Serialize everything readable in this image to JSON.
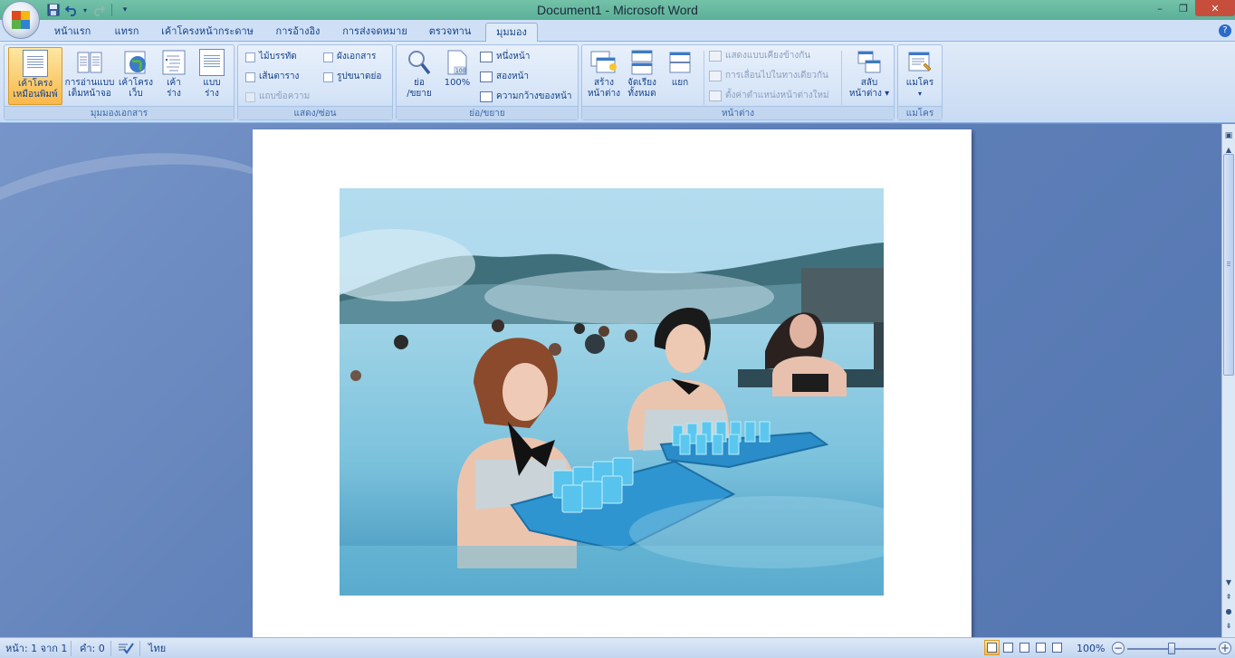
{
  "window": {
    "title": "Document1 - Microsoft Word",
    "close_label": "✕",
    "minimize_label": "–",
    "restore_label": "❐"
  },
  "tabs": [
    {
      "label": "หน้าแรก",
      "active": false
    },
    {
      "label": "แทรก",
      "active": false
    },
    {
      "label": "เค้าโครงหน้ากระดาษ",
      "active": false
    },
    {
      "label": "การอ้างอิง",
      "active": false
    },
    {
      "label": "การส่งจดหมาย",
      "active": false
    },
    {
      "label": "ตรวจทาน",
      "active": false
    },
    {
      "label": "มุมมอง",
      "active": true
    }
  ],
  "ribbon": {
    "document_views": {
      "label": "มุมมองเอกสาร",
      "print_layout": {
        "line1": "เค้าโครง",
        "line2": "เหมือนพิมพ์"
      },
      "full_screen": {
        "line1": "การอ่านแบบ",
        "line2": "เต็มหน้าจอ"
      },
      "web_layout": {
        "line1": "เค้าโครง",
        "line2": "เว็บ"
      },
      "outline": {
        "line1": "เค้า",
        "line2": "ร่าง"
      },
      "draft": {
        "line1": "แบบ",
        "line2": "ร่าง"
      }
    },
    "show_hide": {
      "label": "แสดง/ซ่อน",
      "ruler": "ไม้บรรทัด",
      "gridlines": "เส้นตาราง",
      "message_bar": "แถบข้อความ",
      "document_map": "ผังเอกสาร",
      "thumbnails": "รูปขนาดย่อ"
    },
    "zoom": {
      "label": "ย่อ/ขยาย",
      "zoom_btn": {
        "line1": "ย่อ",
        "line2": "/ขยาย"
      },
      "hundred": "100%",
      "one_page": "หนึ่งหน้า",
      "two_pages": "สองหน้า",
      "page_width": "ความกว้างของหน้า"
    },
    "window": {
      "label": "หน้าต่าง",
      "new_window": {
        "line1": "สร้าง",
        "line2": "หน้าต่าง"
      },
      "arrange_all": {
        "line1": "จัดเรียง",
        "line2": "ทั้งหมด"
      },
      "split": "แยก",
      "side_by_side": "แสดงแบบเคียงข้างกัน",
      "sync_scroll": "การเลื่อนไปในทางเดียวกัน",
      "reset_position": "ตั้งค่าตำแหน่งหน้าต่างใหม่",
      "switch_windows": {
        "line1": "สลับ",
        "line2": "หน้าต่าง ▾"
      }
    },
    "macros": {
      "label": "แมโคร",
      "macros_btn": {
        "line1": "แมโคร",
        "line2": "▾"
      }
    }
  },
  "status": {
    "page": "หน้า: 1 จาก 1",
    "words": "คำ: 0",
    "language": "ไทย",
    "zoom_level": "100%",
    "zoom_minus": "−",
    "zoom_plus": "+"
  },
  "colors": {
    "titlebar": "#5bb097",
    "ribbon_bg": "#dfeaf8",
    "active_button": "#f9b84a",
    "workspace": "#5f80b9",
    "close_button": "#c74d3d"
  }
}
